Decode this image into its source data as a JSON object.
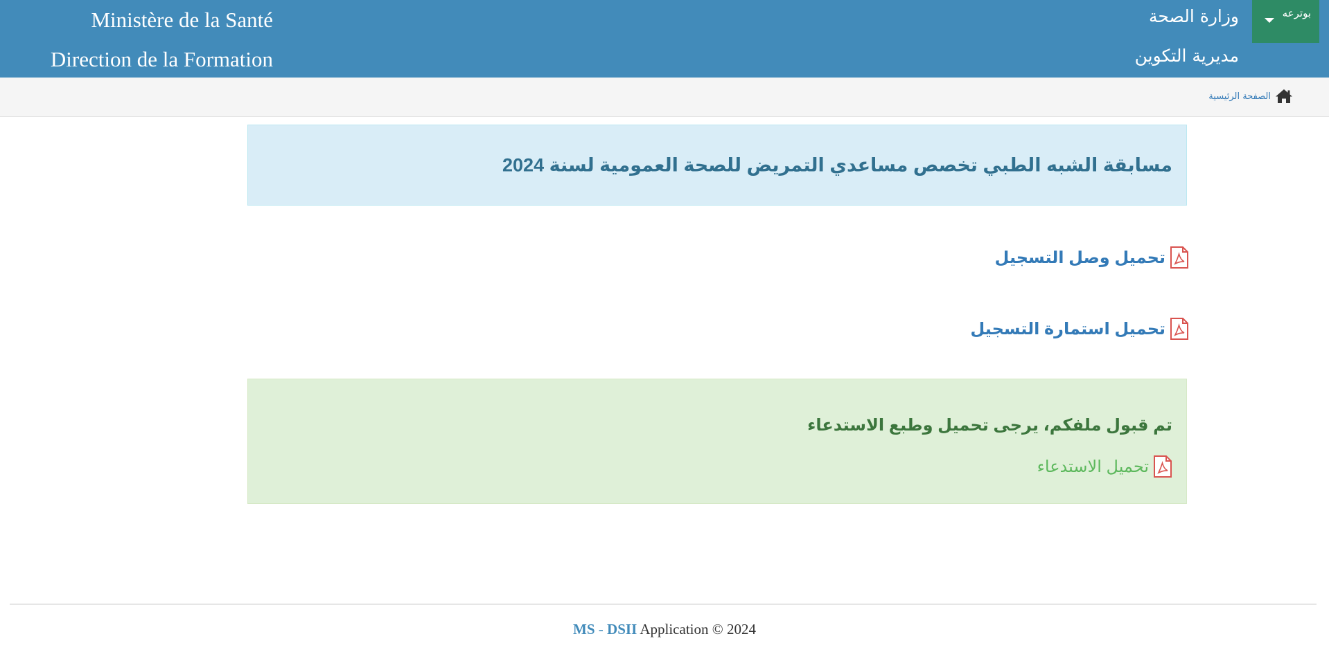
{
  "header": {
    "fr_line1": "Ministère de la Santé",
    "fr_line2": "Direction de la Formation",
    "ar_line1": "وزارة الصحة",
    "ar_line2": "مديرية التكوين",
    "user_menu": {
      "name": "بوترعه",
      "icon": "caret-down-icon"
    },
    "background_color": "#428bba",
    "user_menu_color": "#2e8b65"
  },
  "breadcrumb": {
    "home_label": "الصفحة الرئيسية",
    "icon": "home-icon"
  },
  "main": {
    "contest_title": "مسابقة الشبه الطبي تخصص مساعدي التمريض للصحة العمومية لسنة 2024",
    "downloads": [
      {
        "label": "تحميل وصل التسجيل",
        "icon": "pdf-icon"
      },
      {
        "label": "تحميل استمارة التسجيل",
        "icon": "pdf-icon"
      }
    ],
    "success": {
      "message": "تم قبول ملفكم، يرجى تحميل وطبع الاستدعاء",
      "link_label": "تحميل الاستدعاء",
      "icon": "pdf-icon"
    }
  },
  "footer": {
    "brand_ms": "MS",
    "separator": "-",
    "brand_dsii": "DSII",
    "text": "Application © 2024"
  }
}
